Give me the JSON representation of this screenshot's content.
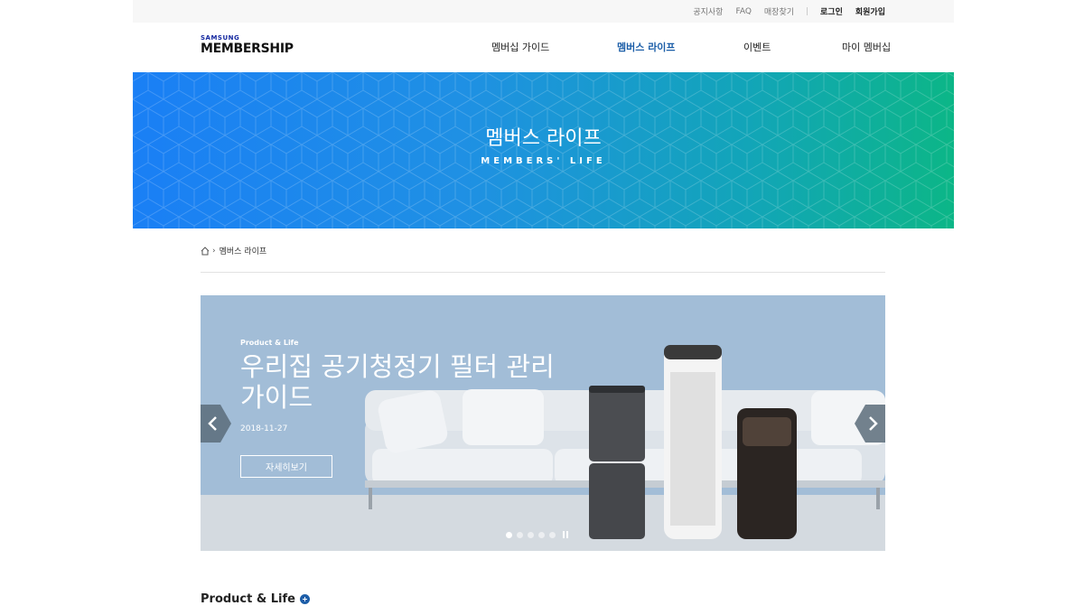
{
  "util_bar": {
    "notice": "공지사항",
    "faq": "FAQ",
    "store": "매장찾기",
    "login": "로그인",
    "join": "회원가입"
  },
  "logo": {
    "brand": "SAMSUNG",
    "name": "MEMBERSHIP"
  },
  "gnb": {
    "items": [
      {
        "label": "멤버십 가이드",
        "active": false
      },
      {
        "label": "멤버스 라이프",
        "active": true
      },
      {
        "label": "이벤트",
        "active": false
      },
      {
        "label": "마이 멤버십",
        "active": false
      }
    ]
  },
  "banner": {
    "title": "멤버스 라이프",
    "subtitle": "MEMBERS' LIFE"
  },
  "breadcrumb": {
    "current": "멤버스 라이프"
  },
  "slider": {
    "category": "Product & Life",
    "title": "우리집 공기청정기 필터 관리 가이드",
    "date": "2018-11-27",
    "button_label": "자세히보기",
    "dot_count": 5,
    "active_dot": 1
  },
  "section": {
    "title": "Product & Life"
  },
  "colors": {
    "accent": "#1c5ea8",
    "banner_start": "#1a7ff5",
    "banner_end": "#0cb687"
  }
}
